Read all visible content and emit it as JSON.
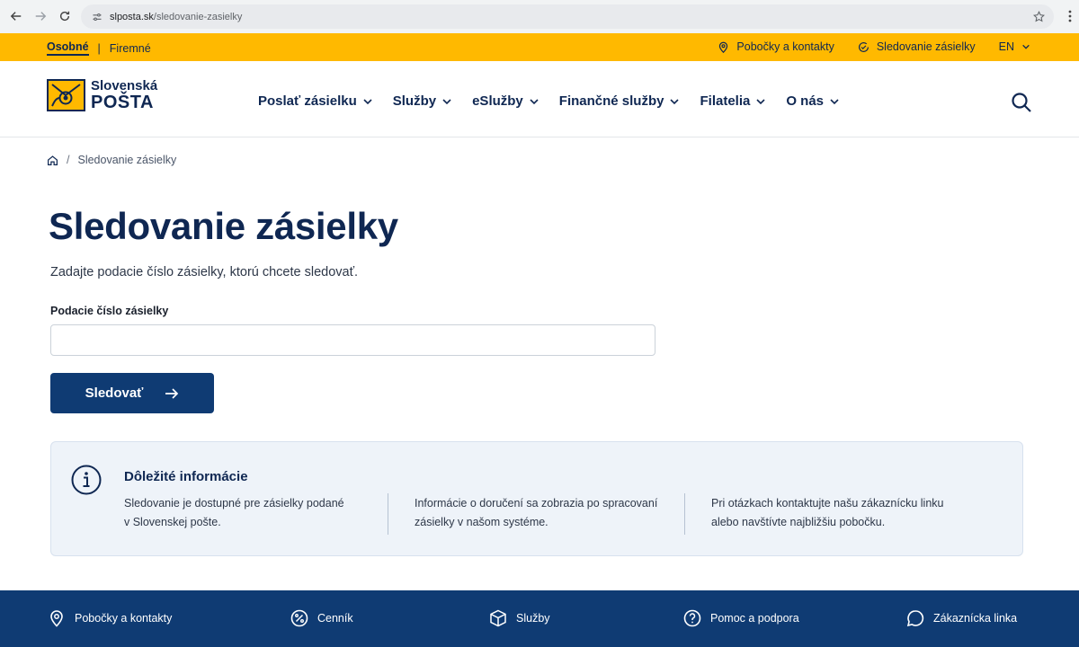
{
  "browser": {
    "url_host": "slposta.sk",
    "url_path": "/sledovanie-zasielky"
  },
  "utility": {
    "segment_active": "Osobné",
    "segment_other": "Firemné",
    "separator": "|",
    "branches": "Pobočky a kontakty",
    "tracking": "Sledovanie zásielky",
    "language": "EN"
  },
  "logo": {
    "line1": "Slovenská",
    "line2": "POŠTA"
  },
  "nav": {
    "items": [
      {
        "label": "Poslať zásielku"
      },
      {
        "label": "Služby"
      },
      {
        "label": "eSlužby"
      },
      {
        "label": "Finančné služby"
      },
      {
        "label": "Filatelia"
      },
      {
        "label": "O nás"
      }
    ]
  },
  "breadcrumb": {
    "current": "Sledovanie zásielky"
  },
  "page": {
    "title": "Sledovanie zásielky",
    "intro": "Zadajte podacie číslo zásielky, ktorú chcete sledovať.",
    "field_label": "Podacie číslo zásielky",
    "field_value": "",
    "button_label": "Sledovať"
  },
  "info": {
    "title": "Dôležité informácie",
    "columns": [
      {
        "line1": "Sledovanie je dostupné pre zásielky podané",
        "line2": "v Slovenskej pošte."
      },
      {
        "line1": "Informácie o doručení sa zobrazia po spracovaní",
        "line2": "zásielky v našom systéme."
      },
      {
        "line1": "Pri otázkach kontaktujte našu zákaznícku linku",
        "line2": "alebo navštívte najbližšiu pobočku."
      }
    ]
  },
  "footer": {
    "items": [
      {
        "label": "Pobočky a kontakty",
        "icon": "location-pin-icon"
      },
      {
        "label": "Cenník",
        "icon": "percent-icon"
      },
      {
        "label": "Služby",
        "icon": "box-icon"
      },
      {
        "label": "Pomoc a podpora",
        "icon": "help-circle-icon"
      },
      {
        "label": "Zákaznícka linka",
        "icon": "chat-bubble-icon"
      }
    ]
  },
  "colors": {
    "brand_yellow": "#ffb900",
    "brand_navy": "#0f2752",
    "button_blue": "#0f3b73",
    "info_bg": "#eef3f9"
  }
}
